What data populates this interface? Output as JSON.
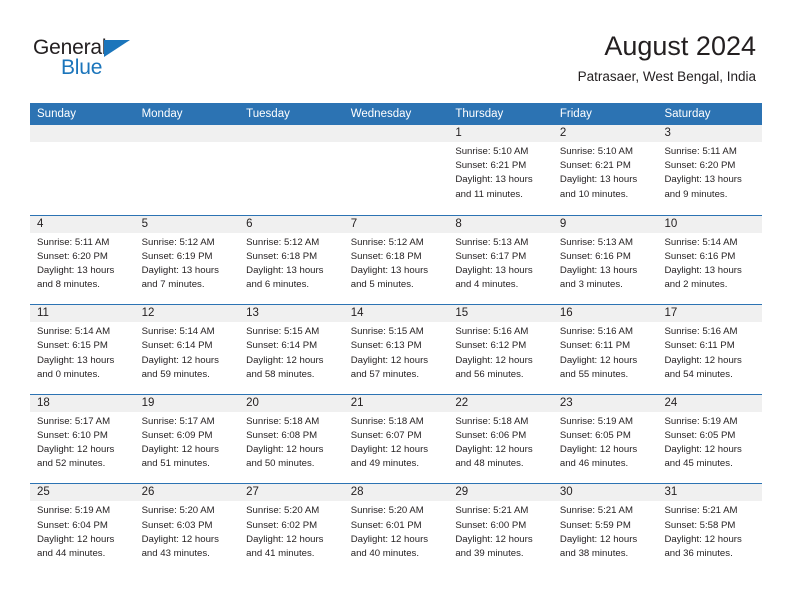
{
  "brand": {
    "name_top": "General",
    "name_bottom": "Blue",
    "accent_color": "#1b75bb"
  },
  "header": {
    "title": "August 2024",
    "subtitle": "Patrasaer, West Bengal, India"
  },
  "theme": {
    "header_bar_color": "#2c73b3",
    "day_band_color": "#f0f0f0",
    "text_color": "#231f20"
  },
  "weekday_headers": [
    "Sunday",
    "Monday",
    "Tuesday",
    "Wednesday",
    "Thursday",
    "Friday",
    "Saturday"
  ],
  "weeks": [
    [
      {
        "day": "",
        "lines": []
      },
      {
        "day": "",
        "lines": []
      },
      {
        "day": "",
        "lines": []
      },
      {
        "day": "",
        "lines": []
      },
      {
        "day": "1",
        "lines": [
          "Sunrise: 5:10 AM",
          "Sunset: 6:21 PM",
          "Daylight: 13 hours",
          "and 11 minutes."
        ]
      },
      {
        "day": "2",
        "lines": [
          "Sunrise: 5:10 AM",
          "Sunset: 6:21 PM",
          "Daylight: 13 hours",
          "and 10 minutes."
        ]
      },
      {
        "day": "3",
        "lines": [
          "Sunrise: 5:11 AM",
          "Sunset: 6:20 PM",
          "Daylight: 13 hours",
          "and 9 minutes."
        ]
      }
    ],
    [
      {
        "day": "4",
        "lines": [
          "Sunrise: 5:11 AM",
          "Sunset: 6:20 PM",
          "Daylight: 13 hours",
          "and 8 minutes."
        ]
      },
      {
        "day": "5",
        "lines": [
          "Sunrise: 5:12 AM",
          "Sunset: 6:19 PM",
          "Daylight: 13 hours",
          "and 7 minutes."
        ]
      },
      {
        "day": "6",
        "lines": [
          "Sunrise: 5:12 AM",
          "Sunset: 6:18 PM",
          "Daylight: 13 hours",
          "and 6 minutes."
        ]
      },
      {
        "day": "7",
        "lines": [
          "Sunrise: 5:12 AM",
          "Sunset: 6:18 PM",
          "Daylight: 13 hours",
          "and 5 minutes."
        ]
      },
      {
        "day": "8",
        "lines": [
          "Sunrise: 5:13 AM",
          "Sunset: 6:17 PM",
          "Daylight: 13 hours",
          "and 4 minutes."
        ]
      },
      {
        "day": "9",
        "lines": [
          "Sunrise: 5:13 AM",
          "Sunset: 6:16 PM",
          "Daylight: 13 hours",
          "and 3 minutes."
        ]
      },
      {
        "day": "10",
        "lines": [
          "Sunrise: 5:14 AM",
          "Sunset: 6:16 PM",
          "Daylight: 13 hours",
          "and 2 minutes."
        ]
      }
    ],
    [
      {
        "day": "11",
        "lines": [
          "Sunrise: 5:14 AM",
          "Sunset: 6:15 PM",
          "Daylight: 13 hours",
          "and 0 minutes."
        ]
      },
      {
        "day": "12",
        "lines": [
          "Sunrise: 5:14 AM",
          "Sunset: 6:14 PM",
          "Daylight: 12 hours",
          "and 59 minutes."
        ]
      },
      {
        "day": "13",
        "lines": [
          "Sunrise: 5:15 AM",
          "Sunset: 6:14 PM",
          "Daylight: 12 hours",
          "and 58 minutes."
        ]
      },
      {
        "day": "14",
        "lines": [
          "Sunrise: 5:15 AM",
          "Sunset: 6:13 PM",
          "Daylight: 12 hours",
          "and 57 minutes."
        ]
      },
      {
        "day": "15",
        "lines": [
          "Sunrise: 5:16 AM",
          "Sunset: 6:12 PM",
          "Daylight: 12 hours",
          "and 56 minutes."
        ]
      },
      {
        "day": "16",
        "lines": [
          "Sunrise: 5:16 AM",
          "Sunset: 6:11 PM",
          "Daylight: 12 hours",
          "and 55 minutes."
        ]
      },
      {
        "day": "17",
        "lines": [
          "Sunrise: 5:16 AM",
          "Sunset: 6:11 PM",
          "Daylight: 12 hours",
          "and 54 minutes."
        ]
      }
    ],
    [
      {
        "day": "18",
        "lines": [
          "Sunrise: 5:17 AM",
          "Sunset: 6:10 PM",
          "Daylight: 12 hours",
          "and 52 minutes."
        ]
      },
      {
        "day": "19",
        "lines": [
          "Sunrise: 5:17 AM",
          "Sunset: 6:09 PM",
          "Daylight: 12 hours",
          "and 51 minutes."
        ]
      },
      {
        "day": "20",
        "lines": [
          "Sunrise: 5:18 AM",
          "Sunset: 6:08 PM",
          "Daylight: 12 hours",
          "and 50 minutes."
        ]
      },
      {
        "day": "21",
        "lines": [
          "Sunrise: 5:18 AM",
          "Sunset: 6:07 PM",
          "Daylight: 12 hours",
          "and 49 minutes."
        ]
      },
      {
        "day": "22",
        "lines": [
          "Sunrise: 5:18 AM",
          "Sunset: 6:06 PM",
          "Daylight: 12 hours",
          "and 48 minutes."
        ]
      },
      {
        "day": "23",
        "lines": [
          "Sunrise: 5:19 AM",
          "Sunset: 6:05 PM",
          "Daylight: 12 hours",
          "and 46 minutes."
        ]
      },
      {
        "day": "24",
        "lines": [
          "Sunrise: 5:19 AM",
          "Sunset: 6:05 PM",
          "Daylight: 12 hours",
          "and 45 minutes."
        ]
      }
    ],
    [
      {
        "day": "25",
        "lines": [
          "Sunrise: 5:19 AM",
          "Sunset: 6:04 PM",
          "Daylight: 12 hours",
          "and 44 minutes."
        ]
      },
      {
        "day": "26",
        "lines": [
          "Sunrise: 5:20 AM",
          "Sunset: 6:03 PM",
          "Daylight: 12 hours",
          "and 43 minutes."
        ]
      },
      {
        "day": "27",
        "lines": [
          "Sunrise: 5:20 AM",
          "Sunset: 6:02 PM",
          "Daylight: 12 hours",
          "and 41 minutes."
        ]
      },
      {
        "day": "28",
        "lines": [
          "Sunrise: 5:20 AM",
          "Sunset: 6:01 PM",
          "Daylight: 12 hours",
          "and 40 minutes."
        ]
      },
      {
        "day": "29",
        "lines": [
          "Sunrise: 5:21 AM",
          "Sunset: 6:00 PM",
          "Daylight: 12 hours",
          "and 39 minutes."
        ]
      },
      {
        "day": "30",
        "lines": [
          "Sunrise: 5:21 AM",
          "Sunset: 5:59 PM",
          "Daylight: 12 hours",
          "and 38 minutes."
        ]
      },
      {
        "day": "31",
        "lines": [
          "Sunrise: 5:21 AM",
          "Sunset: 5:58 PM",
          "Daylight: 12 hours",
          "and 36 minutes."
        ]
      }
    ]
  ]
}
